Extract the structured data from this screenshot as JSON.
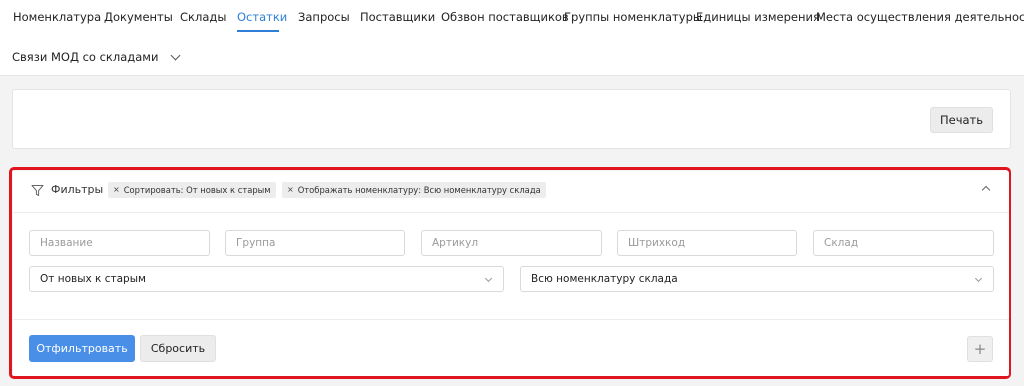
{
  "nav": {
    "items": [
      {
        "label": "Номенклатура"
      },
      {
        "label": "Документы"
      },
      {
        "label": "Склады"
      },
      {
        "label": "Остатки"
      },
      {
        "label": "Запросы"
      },
      {
        "label": "Поставщики"
      },
      {
        "label": "Обзвон поставщиков"
      },
      {
        "label": "Группы номенклатуры"
      },
      {
        "label": "Единицы измерения"
      },
      {
        "label": "Места осуществления деятельности"
      }
    ],
    "more": {
      "label": "Связи МОД со складами"
    },
    "active_index": 3,
    "accent_color": "#2f7fd8"
  },
  "toolbar": {
    "print_label": "Печать"
  },
  "filters": {
    "title": "Фильтры",
    "chips": [
      {
        "x": "×",
        "label": "Сортировать: От новых к старым"
      },
      {
        "x": "×",
        "label": "Отображать номенклатуру: Всю номенклатуру склада"
      }
    ],
    "inputs": {
      "name_placeholder": "Название",
      "group_placeholder": "Группа",
      "article_placeholder": "Артикул",
      "barcode_placeholder": "Штрихкод",
      "warehouse_placeholder": "Склад"
    },
    "sort_select": {
      "value": "От новых к старым"
    },
    "display_select": {
      "value": "Всю номенклатуру склада"
    },
    "apply_label": "Отфильтровать",
    "reset_label": "Сбросить",
    "add_label": "+",
    "highlight_color": "#e0151f",
    "primary_color": "#4a8fe7"
  }
}
